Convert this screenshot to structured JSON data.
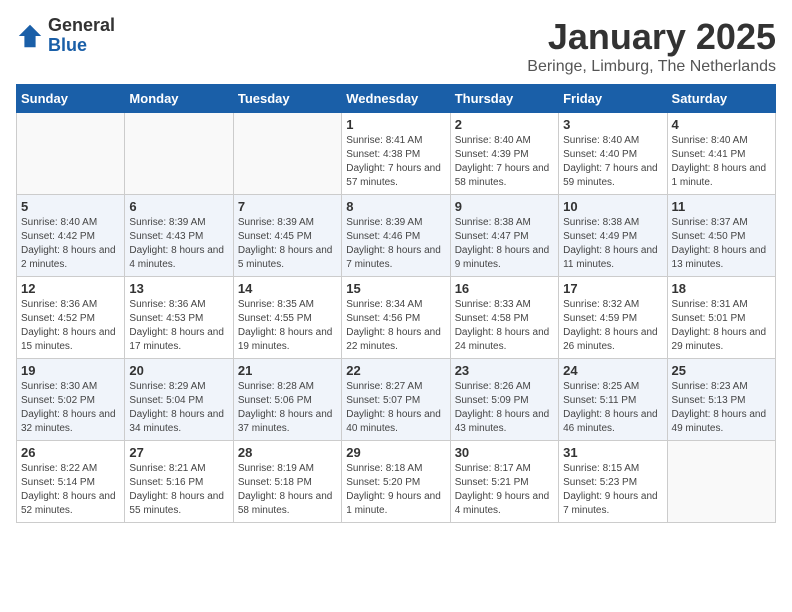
{
  "logo": {
    "general": "General",
    "blue": "Blue"
  },
  "header": {
    "month_title": "January 2025",
    "subtitle": "Beringe, Limburg, The Netherlands"
  },
  "weekdays": [
    "Sunday",
    "Monday",
    "Tuesday",
    "Wednesday",
    "Thursday",
    "Friday",
    "Saturday"
  ],
  "weeks": [
    [
      {
        "day": "",
        "info": ""
      },
      {
        "day": "",
        "info": ""
      },
      {
        "day": "",
        "info": ""
      },
      {
        "day": "1",
        "info": "Sunrise: 8:41 AM\nSunset: 4:38 PM\nDaylight: 7 hours and 57 minutes."
      },
      {
        "day": "2",
        "info": "Sunrise: 8:40 AM\nSunset: 4:39 PM\nDaylight: 7 hours and 58 minutes."
      },
      {
        "day": "3",
        "info": "Sunrise: 8:40 AM\nSunset: 4:40 PM\nDaylight: 7 hours and 59 minutes."
      },
      {
        "day": "4",
        "info": "Sunrise: 8:40 AM\nSunset: 4:41 PM\nDaylight: 8 hours and 1 minute."
      }
    ],
    [
      {
        "day": "5",
        "info": "Sunrise: 8:40 AM\nSunset: 4:42 PM\nDaylight: 8 hours and 2 minutes."
      },
      {
        "day": "6",
        "info": "Sunrise: 8:39 AM\nSunset: 4:43 PM\nDaylight: 8 hours and 4 minutes."
      },
      {
        "day": "7",
        "info": "Sunrise: 8:39 AM\nSunset: 4:45 PM\nDaylight: 8 hours and 5 minutes."
      },
      {
        "day": "8",
        "info": "Sunrise: 8:39 AM\nSunset: 4:46 PM\nDaylight: 8 hours and 7 minutes."
      },
      {
        "day": "9",
        "info": "Sunrise: 8:38 AM\nSunset: 4:47 PM\nDaylight: 8 hours and 9 minutes."
      },
      {
        "day": "10",
        "info": "Sunrise: 8:38 AM\nSunset: 4:49 PM\nDaylight: 8 hours and 11 minutes."
      },
      {
        "day": "11",
        "info": "Sunrise: 8:37 AM\nSunset: 4:50 PM\nDaylight: 8 hours and 13 minutes."
      }
    ],
    [
      {
        "day": "12",
        "info": "Sunrise: 8:36 AM\nSunset: 4:52 PM\nDaylight: 8 hours and 15 minutes."
      },
      {
        "day": "13",
        "info": "Sunrise: 8:36 AM\nSunset: 4:53 PM\nDaylight: 8 hours and 17 minutes."
      },
      {
        "day": "14",
        "info": "Sunrise: 8:35 AM\nSunset: 4:55 PM\nDaylight: 8 hours and 19 minutes."
      },
      {
        "day": "15",
        "info": "Sunrise: 8:34 AM\nSunset: 4:56 PM\nDaylight: 8 hours and 22 minutes."
      },
      {
        "day": "16",
        "info": "Sunrise: 8:33 AM\nSunset: 4:58 PM\nDaylight: 8 hours and 24 minutes."
      },
      {
        "day": "17",
        "info": "Sunrise: 8:32 AM\nSunset: 4:59 PM\nDaylight: 8 hours and 26 minutes."
      },
      {
        "day": "18",
        "info": "Sunrise: 8:31 AM\nSunset: 5:01 PM\nDaylight: 8 hours and 29 minutes."
      }
    ],
    [
      {
        "day": "19",
        "info": "Sunrise: 8:30 AM\nSunset: 5:02 PM\nDaylight: 8 hours and 32 minutes."
      },
      {
        "day": "20",
        "info": "Sunrise: 8:29 AM\nSunset: 5:04 PM\nDaylight: 8 hours and 34 minutes."
      },
      {
        "day": "21",
        "info": "Sunrise: 8:28 AM\nSunset: 5:06 PM\nDaylight: 8 hours and 37 minutes."
      },
      {
        "day": "22",
        "info": "Sunrise: 8:27 AM\nSunset: 5:07 PM\nDaylight: 8 hours and 40 minutes."
      },
      {
        "day": "23",
        "info": "Sunrise: 8:26 AM\nSunset: 5:09 PM\nDaylight: 8 hours and 43 minutes."
      },
      {
        "day": "24",
        "info": "Sunrise: 8:25 AM\nSunset: 5:11 PM\nDaylight: 8 hours and 46 minutes."
      },
      {
        "day": "25",
        "info": "Sunrise: 8:23 AM\nSunset: 5:13 PM\nDaylight: 8 hours and 49 minutes."
      }
    ],
    [
      {
        "day": "26",
        "info": "Sunrise: 8:22 AM\nSunset: 5:14 PM\nDaylight: 8 hours and 52 minutes."
      },
      {
        "day": "27",
        "info": "Sunrise: 8:21 AM\nSunset: 5:16 PM\nDaylight: 8 hours and 55 minutes."
      },
      {
        "day": "28",
        "info": "Sunrise: 8:19 AM\nSunset: 5:18 PM\nDaylight: 8 hours and 58 minutes."
      },
      {
        "day": "29",
        "info": "Sunrise: 8:18 AM\nSunset: 5:20 PM\nDaylight: 9 hours and 1 minute."
      },
      {
        "day": "30",
        "info": "Sunrise: 8:17 AM\nSunset: 5:21 PM\nDaylight: 9 hours and 4 minutes."
      },
      {
        "day": "31",
        "info": "Sunrise: 8:15 AM\nSunset: 5:23 PM\nDaylight: 9 hours and 7 minutes."
      },
      {
        "day": "",
        "info": ""
      }
    ]
  ]
}
